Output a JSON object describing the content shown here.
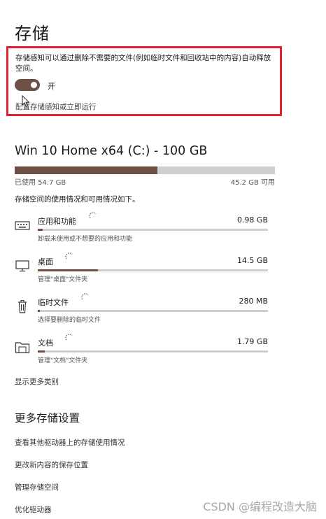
{
  "header": {
    "title": "存储"
  },
  "storage_sense": {
    "description": "存储感知可以通过删除不需要的文件(例如临时文件和回收站中的内容)自动释放空间。",
    "toggle_state": "开",
    "toggle_on": true,
    "configure_link": "配置存储感知或立即运行",
    "highlight_color": "#e0242f"
  },
  "drive": {
    "title": "Win 10 Home x64 (C:) - 100 GB",
    "used_label": "已使用 54.7 GB",
    "free_label": "45.2 GB 可用",
    "used_gb": 54.7,
    "free_gb": 45.2,
    "bar_color": "#6e5046",
    "usage_description": "存储空间的使用情况和可用情况如下。"
  },
  "categories": [
    {
      "name": "应用和功能",
      "size": "0.98 GB",
      "description": "卸载未使用或不想要的应用和功能",
      "icon": "keyboard-icon",
      "usage_fraction": 0.02
    },
    {
      "name": "桌面",
      "size": "14.5 GB",
      "description": "管理\"桌面\"文件夹",
      "icon": "monitor-icon",
      "usage_fraction": 0.26
    },
    {
      "name": "临时文件",
      "size": "280 MB",
      "description": "选择要删除的临时文件",
      "icon": "trash-icon",
      "usage_fraction": 0.01
    },
    {
      "name": "文档",
      "size": "1.79 GB",
      "description": "管理\"文档\"文件夹",
      "icon": "folder-icon",
      "usage_fraction": 0.03
    }
  ],
  "show_more": "显示更多类别",
  "more_settings": {
    "title": "更多存储设置",
    "links": [
      "查看其他驱动器上的存储使用情况",
      "更改新内容的保存位置",
      "管理存储空间",
      "优化驱动器"
    ]
  },
  "watermark": "CSDN @编程改造大脑"
}
